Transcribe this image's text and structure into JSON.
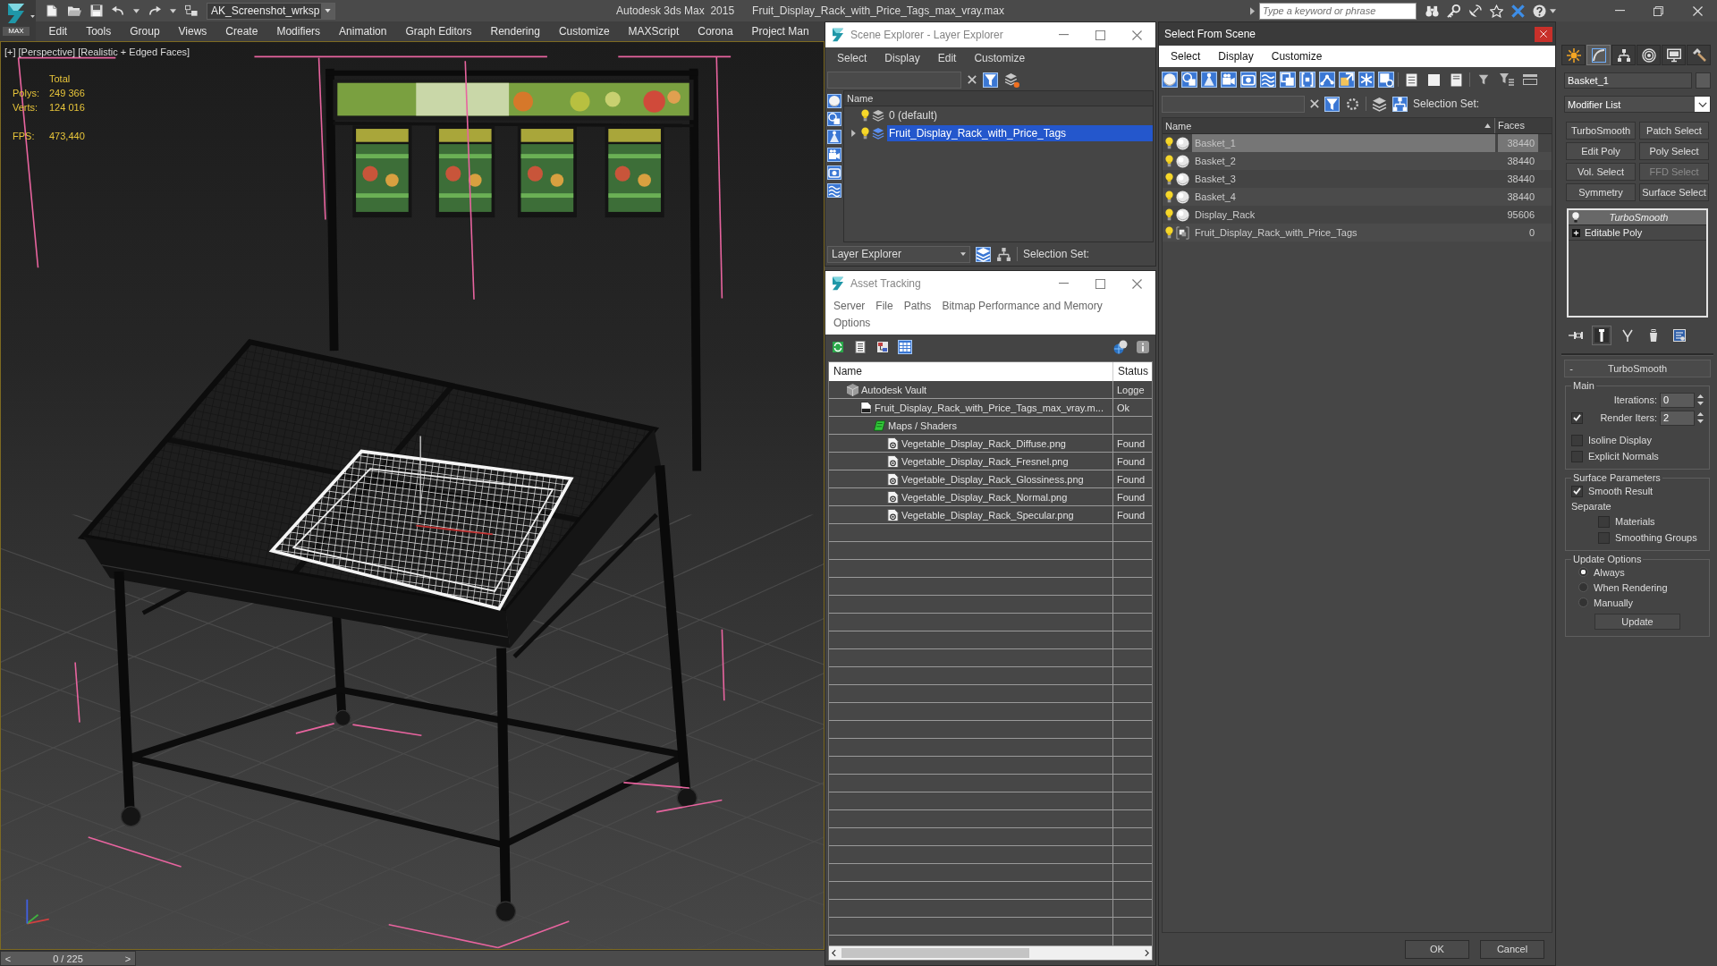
{
  "title_bar": {
    "logo_text": "MAX",
    "workspace": "AK_Screenshot_wrksp",
    "app_name": "Autodesk 3ds Max  2015",
    "file_name": "Fruit_Display_Rack_with_Price_Tags_max_vray.max",
    "search": {
      "placeholder": "Type a keyword or phrase"
    }
  },
  "menu_bar": [
    "Edit",
    "Tools",
    "Group",
    "Views",
    "Create",
    "Modifiers",
    "Animation",
    "Graph Editors",
    "Rendering",
    "Customize",
    "MAXScript",
    "Corona",
    "Project Man"
  ],
  "viewport": {
    "labels": [
      "[+]",
      "[Perspective]",
      "[Realistic + Edged Faces]"
    ],
    "stats_heading": "Total",
    "stats": [
      {
        "label": "Polys:",
        "value": "249 366"
      },
      {
        "label": "Verts:",
        "value": "124 016"
      }
    ],
    "fps": {
      "label": "FPS:",
      "value": "473,440"
    }
  },
  "time_slider": {
    "prev": "<",
    "position": "0 / 225",
    "next": ">",
    "level": 0
  },
  "scene_explorer": {
    "title": "Scene Explorer - Layer Explorer",
    "menu": [
      "Select",
      "Display",
      "Edit",
      "Customize"
    ],
    "search_tools": [
      {
        "kind": "filter",
        "on": true
      },
      {
        "kind": "layer_filter",
        "on": false
      }
    ],
    "type_filters": [
      {
        "kind": "geometry",
        "on": true
      },
      {
        "kind": "shapes",
        "on": true
      },
      {
        "kind": "lights",
        "on": true
      },
      {
        "kind": "cameras",
        "on": true
      },
      {
        "kind": "helpers",
        "on": true
      },
      {
        "kind": "space_warps",
        "on": true
      }
    ],
    "column": "Name",
    "layers": [
      {
        "name": "0 (default)",
        "has_expander": false,
        "selected": false
      },
      {
        "name": "Fruit_Display_Rack_with_Price_Tags",
        "has_expander": true,
        "selected": true
      }
    ],
    "explorer_dropdown": "Layer Explorer",
    "view_tools": [
      {
        "kind": "layers",
        "on": true
      },
      {
        "kind": "hierarchy",
        "on": false
      }
    ],
    "selection_set_label": "Selection Set:"
  },
  "asset_tracking": {
    "title": "Asset Tracking",
    "menu": [
      "Server",
      "File",
      "Paths",
      "Bitmap Performance and Memory",
      "Options"
    ],
    "toolbar": [
      {
        "kind": "refresh",
        "on": false
      },
      {
        "kind": "list",
        "on": false
      },
      {
        "kind": "tree",
        "on": false
      },
      {
        "kind": "table",
        "on": true
      }
    ],
    "columns": [
      "Name",
      "Status"
    ],
    "assets": [
      {
        "kind": "vault",
        "name": "Autodesk Vault",
        "status": "Logge",
        "children": [
          {
            "kind": "max_file",
            "name": "Fruit_Display_Rack_with_Price_Tags_max_vray.m...",
            "status": "Ok",
            "children": [
              {
                "kind": "maps",
                "name": "Maps / Shaders",
                "children": [
                  {
                    "kind": "bitmap",
                    "name": "Vegetable_Display_Rack_Diffuse.png",
                    "status": "Found"
                  },
                  {
                    "kind": "bitmap",
                    "name": "Vegetable_Display_Rack_Fresnel.png",
                    "status": "Found"
                  },
                  {
                    "kind": "bitmap",
                    "name": "Vegetable_Display_Rack_Glossiness.png",
                    "status": "Found"
                  },
                  {
                    "kind": "bitmap",
                    "name": "Vegetable_Display_Rack_Normal.png",
                    "status": "Found"
                  },
                  {
                    "kind": "bitmap",
                    "name": "Vegetable_Display_Rack_Specular.png",
                    "status": "Found"
                  }
                ]
              }
            ]
          }
        ]
      }
    ]
  },
  "select_from_scene": {
    "title": "Select From Scene",
    "menu": [
      "Select",
      "Display",
      "Customize"
    ],
    "type_filters": [
      {
        "kind": "geometry",
        "on": true
      },
      {
        "kind": "shapes",
        "on": true
      },
      {
        "kind": "lights",
        "on": true
      },
      {
        "kind": "cameras",
        "on": true
      },
      {
        "kind": "helpers",
        "on": true
      },
      {
        "kind": "space_warps",
        "on": true
      },
      {
        "kind": "groups",
        "on": true
      },
      {
        "kind": "containers",
        "on": true
      },
      {
        "kind": "bones",
        "on": true
      },
      {
        "kind": "xrefs",
        "on": true
      },
      {
        "kind": "frozen",
        "on": true
      },
      {
        "kind": "hidden",
        "on": true
      }
    ],
    "search_tools": [
      {
        "kind": "filter",
        "on": true
      },
      {
        "kind": "settings_filter",
        "on": false
      }
    ],
    "view_tools": [
      {
        "kind": "layers",
        "on": false
      },
      {
        "kind": "hierarchy",
        "on": true
      }
    ],
    "selection_set_label": "Selection Set:",
    "columns": [
      "Name",
      "Faces"
    ],
    "rows": [
      {
        "kind": "geometry",
        "name": "Basket_1",
        "faces": "38440",
        "selected": true
      },
      {
        "kind": "geometry",
        "name": "Basket_2",
        "faces": "38440",
        "selected": false
      },
      {
        "kind": "geometry",
        "name": "Basket_3",
        "faces": "38440",
        "selected": false
      },
      {
        "kind": "geometry",
        "name": "Basket_4",
        "faces": "38440",
        "selected": false
      },
      {
        "kind": "geometry",
        "name": "Display_Rack",
        "faces": "95606",
        "selected": false
      },
      {
        "kind": "group",
        "name": "Fruit_Display_Rack_with_Price_Tags",
        "faces": "0",
        "selected": false
      }
    ],
    "buttons": [
      "OK",
      "Cancel"
    ]
  },
  "command_panel": {
    "tabs": [
      {
        "kind": "create",
        "selected": false
      },
      {
        "kind": "modify",
        "selected": true
      },
      {
        "kind": "hierarchy",
        "selected": false
      },
      {
        "kind": "motion",
        "selected": false
      },
      {
        "kind": "display",
        "selected": false
      },
      {
        "kind": "utilities",
        "selected": false
      }
    ],
    "object_name": "Basket_1",
    "modifier_list": "Modifier List",
    "modifier_buttons": [
      {
        "label": "TurboSmooth",
        "disabled": false
      },
      {
        "label": "Patch Select",
        "disabled": false
      },
      {
        "label": "Edit Poly",
        "disabled": false
      },
      {
        "label": "Poly Select",
        "disabled": false
      },
      {
        "label": "Vol. Select",
        "disabled": false
      },
      {
        "label": "FFD Select",
        "disabled": true
      },
      {
        "label": "Symmetry",
        "disabled": false
      },
      {
        "label": "Surface Select",
        "disabled": false
      }
    ],
    "stack": [
      {
        "kind": "modifier",
        "label": "TurboSmooth",
        "selected": true
      },
      {
        "kind": "base_object",
        "label": "Editable Poly",
        "selected": false
      }
    ],
    "stack_tools": [
      {
        "kind": "pin",
        "on": false
      },
      {
        "kind": "end_result",
        "on": true
      },
      {
        "kind": "make_unique",
        "on": false
      },
      {
        "kind": "remove",
        "on": false
      },
      {
        "kind": "configure",
        "on": false
      }
    ],
    "rollout": {
      "toggle": "-",
      "title": "TurboSmooth",
      "groups": [
        {
          "title": "Main",
          "items": [
            {
              "kind": "spinner",
              "label": "Iterations:",
              "value": "0"
            },
            {
              "kind": "check_spinner",
              "label": "Render Iters:",
              "value": "2",
              "checked": true
            },
            {
              "kind": "checkbox",
              "label": "Isoline Display",
              "checked": false
            },
            {
              "kind": "checkbox",
              "label": "Explicit Normals",
              "checked": false
            }
          ]
        },
        {
          "title": "Surface Parameters",
          "items": [
            {
              "kind": "checkbox",
              "label": "Smooth Result",
              "checked": true
            },
            {
              "kind": "label",
              "label": "Separate",
              "children": [
                {
                  "kind": "checkbox",
                  "label": "Materials",
                  "checked": false
                },
                {
                  "kind": "checkbox",
                  "label": "Smoothing Groups",
                  "checked": false
                }
              ]
            }
          ]
        },
        {
          "title": "Update Options",
          "items": [
            {
              "kind": "radio",
              "label": "Always",
              "selected": true
            },
            {
              "kind": "radio",
              "label": "When Rendering",
              "selected": false
            },
            {
              "kind": "radio",
              "label": "Manually",
              "selected": false
            },
            {
              "kind": "button",
              "label": "Update"
            }
          ]
        }
      ]
    }
  }
}
